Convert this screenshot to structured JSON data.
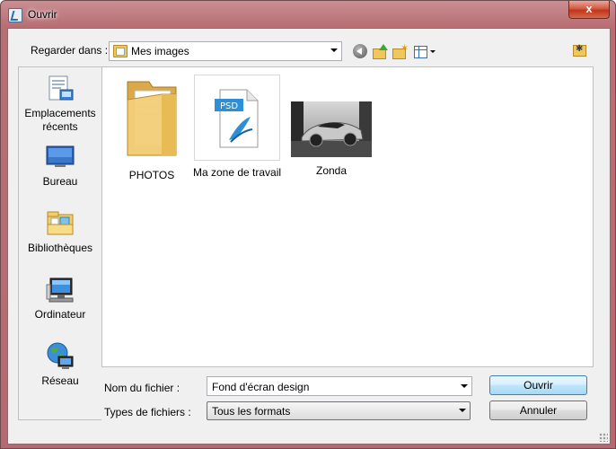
{
  "window": {
    "title": "Ouvrir",
    "close_glyph": "x"
  },
  "toolbar": {
    "look_in_label": "Regarder dans :",
    "look_in_value": "Mes images",
    "icons": [
      "back-icon",
      "up-folder-icon",
      "new-folder-icon",
      "view-menu-icon",
      "favorite-folder-icon"
    ]
  },
  "places": [
    {
      "label": "Emplacements récents",
      "icon": "recent-places-icon"
    },
    {
      "label": "Bureau",
      "icon": "desktop-icon"
    },
    {
      "label": "Bibliothèques",
      "icon": "libraries-icon"
    },
    {
      "label": "Ordinateur",
      "icon": "computer-icon"
    },
    {
      "label": "Réseau",
      "icon": "network-icon"
    }
  ],
  "files": [
    {
      "name": "PHOTOS",
      "icon": "folder-icon"
    },
    {
      "name": "Ma zone de travail",
      "icon": "psd-file-icon"
    },
    {
      "name": "Zonda",
      "icon": "image-thumbnail"
    }
  ],
  "bottom": {
    "filename_label": "Nom du fichier :",
    "filename_value": "Fond d'écran design",
    "filetype_label": "Types de fichiers :",
    "filetype_value": "Tous les formats",
    "open_label": "Ouvrir",
    "cancel_label": "Annuler"
  }
}
